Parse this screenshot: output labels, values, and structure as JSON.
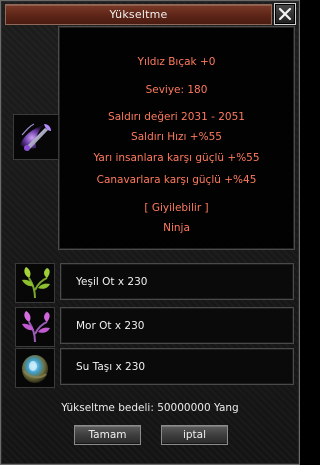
{
  "window": {
    "title": "Yükseltme",
    "close_icon": "close-icon"
  },
  "item": {
    "icon": "dagger-icon",
    "name": "Yıldız Bıçak +0",
    "level": "Seviye: 180",
    "attack_value": "Saldırı değeri 2031 - 2051",
    "attack_speed": "Saldırı Hızı +%55",
    "vs_half_humans": "Yarı insanlara karşı güçlü +%55",
    "vs_monsters": "Canavarlara karşı güçlü +%45",
    "wearable": "[ Giyilebilir ]",
    "class": "Ninja"
  },
  "materials": [
    {
      "icon": "green-herb-icon",
      "label": "Yeşil Ot x 230"
    },
    {
      "icon": "purple-herb-icon",
      "label": "Mor Ot x 230"
    },
    {
      "icon": "water-stone-icon",
      "label": "Su Taşı x 230"
    }
  ],
  "cost": "Yükseltme bedeli: 50000000 Yang",
  "buttons": {
    "ok": "Tamam",
    "cancel": "iptal"
  },
  "colors": {
    "stat_text": "#ff7a5e",
    "title_bar": "#5d2517"
  }
}
